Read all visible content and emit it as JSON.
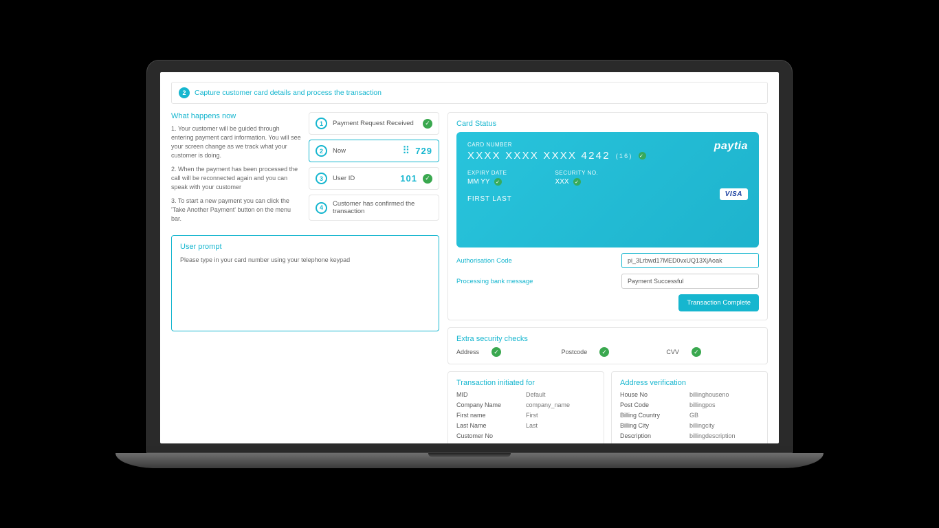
{
  "header": {
    "step_number": "2",
    "title": "Capture customer card details and process the transaction"
  },
  "what_happens": {
    "title": "What happens now",
    "p1": "1. Your customer will be guided through entering payment card information. You will see your screen change as we track what your customer is doing.",
    "p2": "2. When the payment has been processed the call will be reconnected again and you can speak with your customer",
    "p3": "3. To start a new payment you can click the 'Take Another Payment' button on the menu bar."
  },
  "steps": {
    "s1": {
      "num": "1",
      "label": "Payment Request Received"
    },
    "s2": {
      "num": "2",
      "label": "Now",
      "value": "729"
    },
    "s3": {
      "num": "3",
      "label": "User ID",
      "value": "101"
    },
    "s4": {
      "num": "4",
      "label": "Customer has confirmed the transaction"
    }
  },
  "user_prompt": {
    "title": "User prompt",
    "text": "Please type in your card number using your telephone keypad"
  },
  "card_status": {
    "title": "Card Status",
    "brand": "paytia",
    "card_number_label": "CARD NUMBER",
    "card_number": "XXXX XXXX XXXX 4242",
    "card_digits_count": "(16)",
    "expiry_label": "EXPIRY DATE",
    "expiry_value": "MM YY",
    "security_label": "SECURITY NO.",
    "security_value": "XXX",
    "holder": "FIRST LAST",
    "visa": "VISA"
  },
  "auth": {
    "code_label": "Authorisation Code",
    "code_value": "pi_3Lrbwd17MED0vxUQ13XjAoak",
    "bank_label": "Processing bank message",
    "bank_value": "Payment Successful",
    "button": "Transaction Complete"
  },
  "security_checks": {
    "title": "Extra security checks",
    "address": "Address",
    "postcode": "Postcode",
    "cvv": "CVV"
  },
  "tx_initiated": {
    "title": "Transaction initiated for",
    "rows": {
      "mid_k": "MID",
      "mid_v": "Default",
      "company_k": "Company Name",
      "company_v": "company_name",
      "first_k": "First name",
      "first_v": "First",
      "last_k": "Last Name",
      "last_v": "Last",
      "cust_k": "Customer No",
      "cust_v": ""
    }
  },
  "addr_verif": {
    "title": "Address verification",
    "rows": {
      "house_k": "House No",
      "house_v": "billinghouseno",
      "post_k": "Post Code",
      "post_v": "billingpos",
      "country_k": "Billing Country",
      "country_v": "GB",
      "city_k": "Billing City",
      "city_v": "billingcity",
      "desc_k": "Description",
      "desc_v": "billingdescription"
    }
  }
}
